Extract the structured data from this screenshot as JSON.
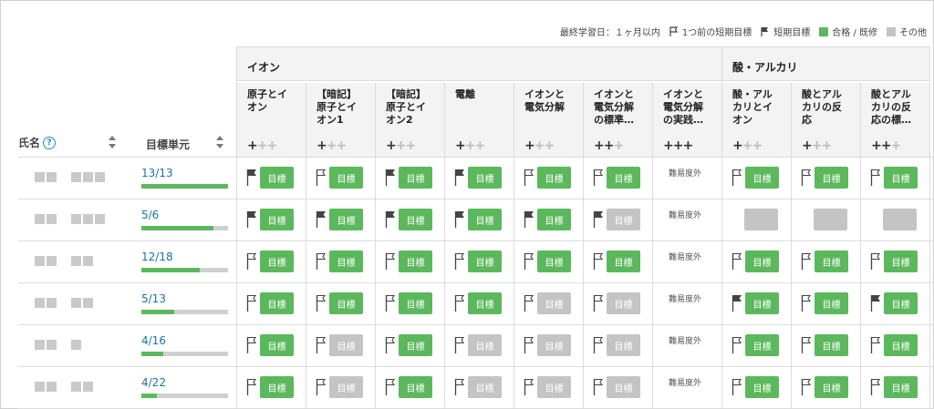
{
  "legend": {
    "last_study": "最終学習日：１ヶ月以内",
    "prev_target": "1つ前の短期目標",
    "short_target": "短期目標",
    "passed": "合格 / 既修",
    "other": "その他",
    "colors": {
      "passed": "#5cb85c",
      "other": "#c4c4c4"
    }
  },
  "header": {
    "name_label": "氏名",
    "help_symbol": "?",
    "target_label": "目標単元"
  },
  "groups": [
    {
      "title": "イオン"
    },
    {
      "title": "酸・アルカリ"
    }
  ],
  "columns": [
    {
      "title": "原子とイ\nオン",
      "level": 1
    },
    {
      "title": "【暗記】\n原子とイ\nオン1",
      "level": 1
    },
    {
      "title": "【暗記】\n原子とイ\nオン2",
      "level": 1
    },
    {
      "title": "電離",
      "level": 1
    },
    {
      "title": "イオンと\n電気分解",
      "level": 1
    },
    {
      "title": "イオンと\n電気分解\nの標準…",
      "level": 2
    },
    {
      "title": "イオンと\n電気分解\nの実践…",
      "level": 3
    },
    {
      "title": "酸・アル\nカリとイ\nオン",
      "level": 1
    },
    {
      "title": "酸とアル\nカリの反\n応",
      "level": 1
    },
    {
      "title": "酸とアル\nカリの反\n応の標…",
      "level": 2
    }
  ],
  "labels": {
    "target": "目標",
    "out_of_scope": "難易度外"
  },
  "students": [
    {
      "name_blocks": [
        2,
        3
      ],
      "progress": "13/13",
      "ratio": 1.0,
      "cells": [
        "pfg",
        "ffg",
        "pfg",
        "pfg",
        "ffg",
        "ffg",
        "ext",
        "ffg",
        "ffg",
        "ffg"
      ]
    },
    {
      "name_blocks": [
        2,
        3
      ],
      "progress": "5/6",
      "ratio": 0.83,
      "cells": [
        "pfg",
        "pfg",
        "pfg",
        "pfg",
        "pfg",
        "pfx",
        "ext",
        "bl",
        "bl",
        "bl"
      ]
    },
    {
      "name_blocks": [
        2,
        2
      ],
      "progress": "12/18",
      "ratio": 0.67,
      "cells": [
        "ffg",
        "ffg",
        "ffg",
        "ffg",
        "ffg",
        "ffg",
        "ext",
        "ffg",
        "ffg",
        "ffg"
      ]
    },
    {
      "name_blocks": [
        2,
        2
      ],
      "progress": "5/13",
      "ratio": 0.38,
      "cells": [
        "ffg",
        "ffg",
        "ffg",
        "ffg",
        "ffx",
        "ffx",
        "ext",
        "pfg",
        "ffg",
        "pfg"
      ]
    },
    {
      "name_blocks": [
        2,
        1
      ],
      "progress": "4/16",
      "ratio": 0.25,
      "cells": [
        "ffg",
        "ffx",
        "ffg",
        "ffx",
        "ffx",
        "ffx",
        "ext",
        "ffg",
        "ffg",
        "ffg"
      ]
    },
    {
      "name_blocks": [
        2,
        2
      ],
      "progress": "4/22",
      "ratio": 0.18,
      "cells": [
        "ffg",
        "ffx",
        "ffg",
        "ffx",
        "ffx",
        "ffx",
        "ext",
        "ffg",
        "ffg",
        "ffg"
      ]
    }
  ]
}
